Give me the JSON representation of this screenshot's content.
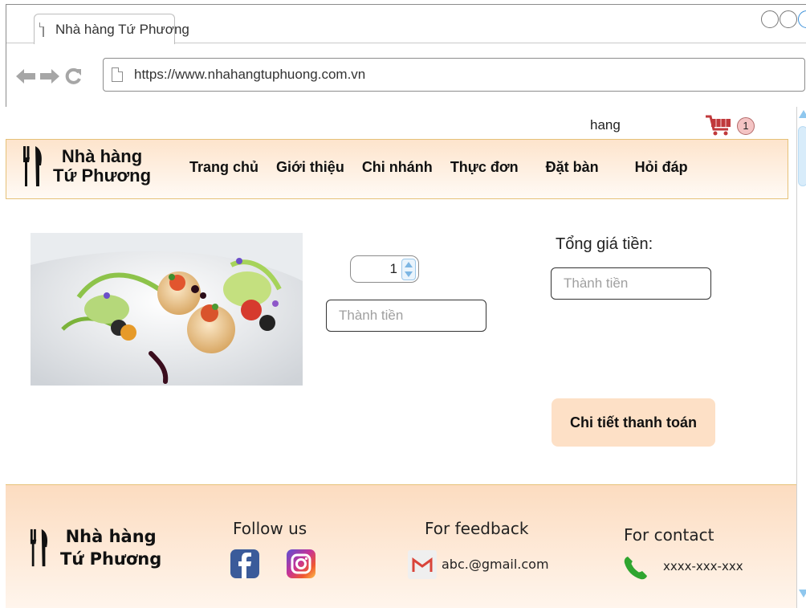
{
  "browser": {
    "tab_title": "Nhà hàng Tứ Phương",
    "url": "https://www.nhahangtuphuong.com.vn"
  },
  "header": {
    "user_name": "hang",
    "cart_count": "1"
  },
  "brand": {
    "line1": "Nhà hàng",
    "line2": "Tứ Phương"
  },
  "nav": {
    "items": [
      "Trang chủ",
      "Giới thiệu",
      "Chi nhánh",
      "Thực đơn",
      "Đặt bàn",
      "Hỏi đáp"
    ]
  },
  "cart_item": {
    "image_icon": "plated-scallops-dish-photo",
    "quantity": "1",
    "line_total_placeholder": "Thành tiền"
  },
  "summary": {
    "grand_total_label": "Tổng giá tiền:",
    "grand_total_placeholder": "Thành tiền",
    "checkout_button": "Chi tiết thanh toán"
  },
  "footer": {
    "follow_title": "Follow us",
    "feedback_title": "For feedback",
    "feedback_email": "abc.@gmail.com",
    "contact_title": "For contact",
    "contact_phone": "xxxx-xxx-xxx"
  },
  "colors": {
    "nav_background": "#fde4cc",
    "accent_border": "#e6c178",
    "button_background": "#fde0c6",
    "facebook": "#3b5b9a",
    "phone": "#2fa52f"
  }
}
